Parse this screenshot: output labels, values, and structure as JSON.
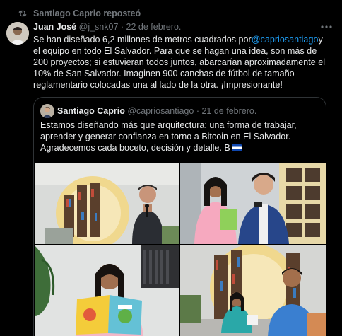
{
  "repost": {
    "label": "Santiago Caprio reposteó",
    "icon": "repost-icon"
  },
  "tweet": {
    "author_name": "Juan José",
    "author_handle": "@j_snk07",
    "separator": "·",
    "date": "22 de febrero.",
    "text_before_mention": "Se han diseñado 6,2 millones de metros cuadrados por",
    "mention": "@capriosantiago",
    "text_after_mention": "y el equipo en todo El Salvador. Para que se hagan una idea, son más de 200 proyectos; si estuvieran todos juntos, abarcarían aproximadamente el 10% de San Salvador. Imaginen 900 canchas de fútbol de tamaño reglamentario colocadas una al lado de la otra. ¡Impresionante!",
    "more_icon": "more-icon"
  },
  "quote": {
    "author_name": "Santiago Caprio",
    "author_handle": "@capriosantiago",
    "separator": "·",
    "date": "21 de febrero.",
    "text": "Estamos diseñando más que arquitectura: una forma de trabajar, aprender y generar confianza en torno a Bitcoin en El Salvador. Agradecemos cada boceto, decisión y detalle. B",
    "flag_icon": "el-salvador-flag-icon"
  },
  "colors": {
    "background": "#000000",
    "text": "#e7e9ea",
    "muted": "#71767b",
    "link": "#1d9bf0",
    "border": "#2f3336"
  }
}
